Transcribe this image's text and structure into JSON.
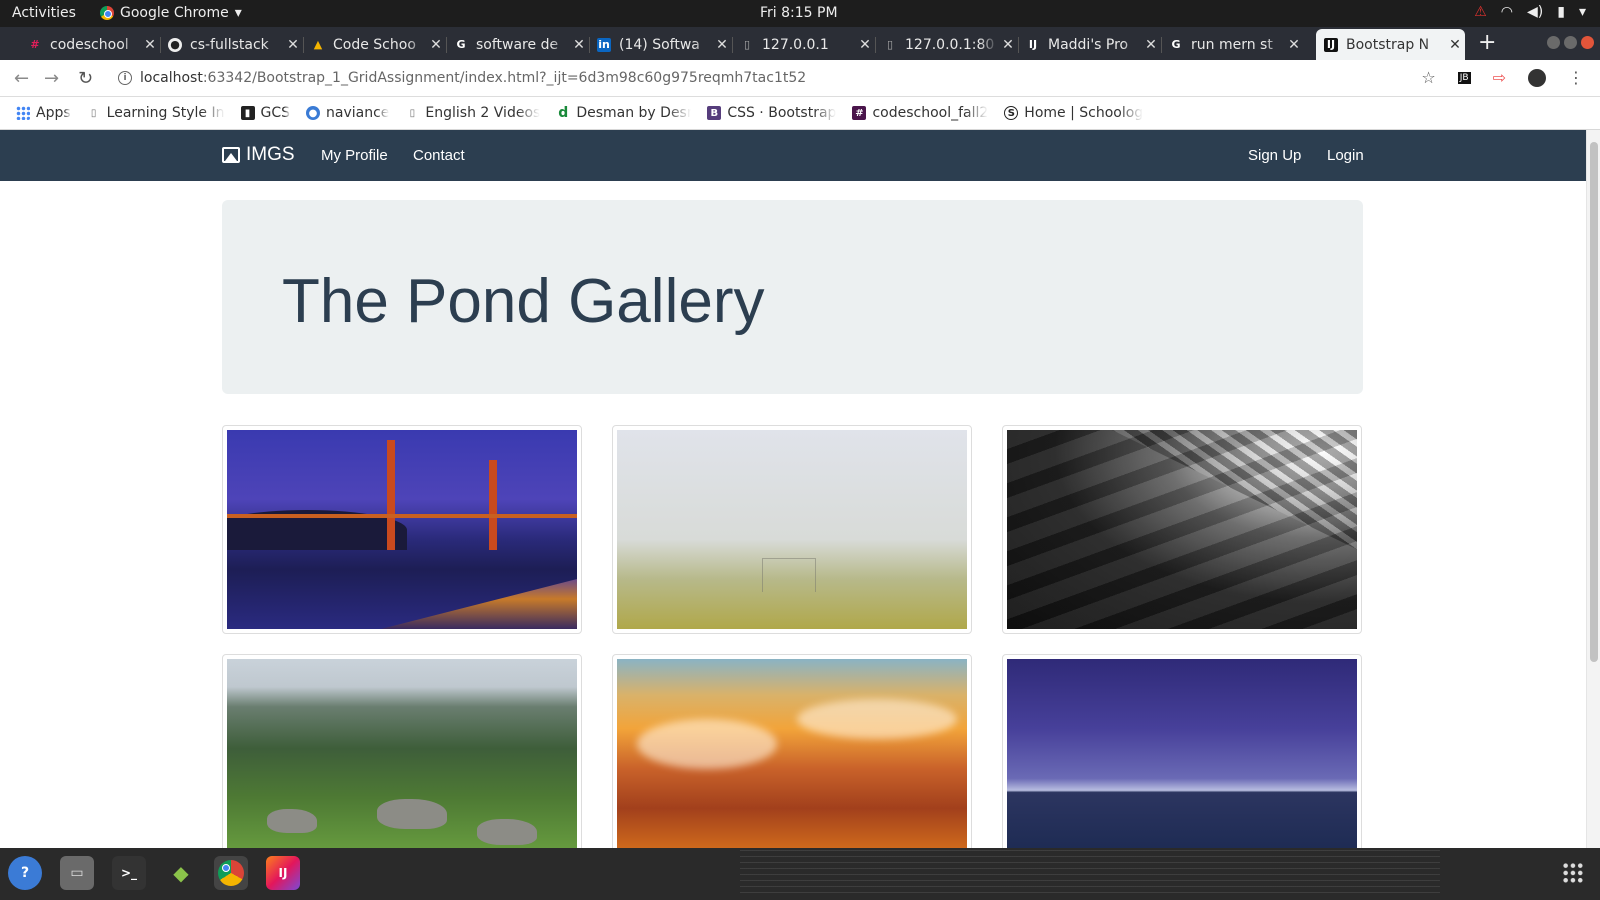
{
  "topbar": {
    "activities": "Activities",
    "app_name": "Google Chrome",
    "clock": "Fri  8:15 PM"
  },
  "tabs": [
    {
      "title": "codeschool",
      "icon": "slack-icon"
    },
    {
      "title": "cs-fullstack",
      "icon": "github-icon"
    },
    {
      "title": "Code Schoo",
      "icon": "google-drive-icon"
    },
    {
      "title": "software de",
      "icon": "google-icon"
    },
    {
      "title": "(14) Softwa",
      "icon": "linkedin-icon"
    },
    {
      "title": "127.0.0.1",
      "icon": "page-icon"
    },
    {
      "title": "127.0.0.1:80",
      "icon": "page-icon"
    },
    {
      "title": "Maddi's Pro",
      "icon": "jetbrains-icon"
    },
    {
      "title": "run mern st",
      "icon": "google-icon"
    },
    {
      "title": "Bootstrap N",
      "icon": "jetbrains-icon"
    }
  ],
  "address": {
    "host": "localhost",
    "path": ":63342/Bootstrap_1_GridAssignment/index.html?_ijt=6d3m98c60g975reqmh7tac1t52"
  },
  "bookmarks": [
    {
      "label": "Apps",
      "icon": "apps-grid-icon"
    },
    {
      "label": "Learning Style In",
      "icon": "page-icon"
    },
    {
      "label": "GCS",
      "icon": "gcs-icon"
    },
    {
      "label": "naviance",
      "icon": "naviance-icon"
    },
    {
      "label": "English 2 Videos",
      "icon": "page-icon"
    },
    {
      "label": "Desman by Desm",
      "icon": "desman-icon"
    },
    {
      "label": "CSS · Bootstrap",
      "icon": "bootstrap-icon"
    },
    {
      "label": "codeschool_fall2",
      "icon": "slack-icon"
    },
    {
      "label": "Home | Schoolog",
      "icon": "schoology-icon"
    }
  ],
  "site": {
    "brand": "IMGS",
    "nav_left": [
      "My Profile",
      "Contact"
    ],
    "nav_right": [
      "Sign Up",
      "Login"
    ],
    "heading": "The Pond Gallery"
  },
  "gallery": [
    {
      "subject": "golden-gate-bridge-at-dusk"
    },
    {
      "subject": "foggy-soccer-field"
    },
    {
      "subject": "black-and-white-architecture"
    },
    {
      "subject": "green-mountain-valley"
    },
    {
      "subject": "sunset-over-clouds"
    },
    {
      "subject": "purple-sky-over-sea"
    }
  ],
  "colors": {
    "nav_bg": "#2c3e50",
    "jumbotron_bg": "#ecf0f1",
    "heading": "#2c3e50"
  }
}
